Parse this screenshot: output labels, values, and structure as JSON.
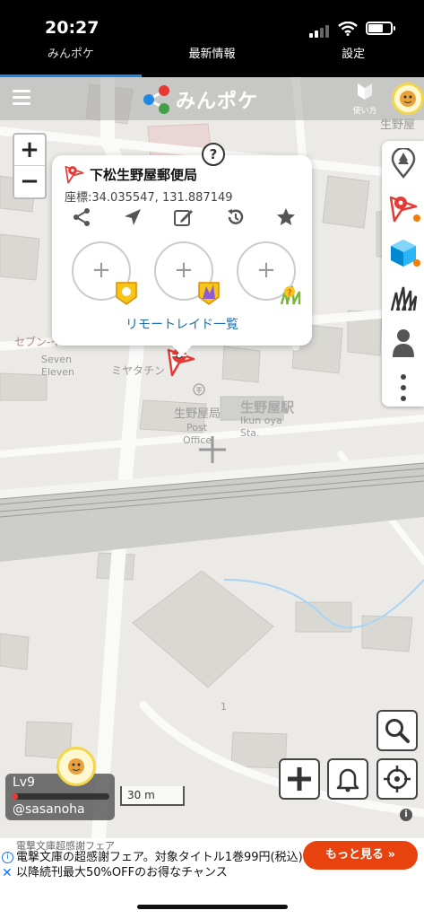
{
  "status_bar": {
    "time": "20:27"
  },
  "tabs": [
    {
      "label": "みんポケ",
      "active": true
    },
    {
      "label": "最新情報",
      "active": false
    },
    {
      "label": "設定",
      "active": false
    }
  ],
  "header": {
    "logo_text": "みんポケ",
    "howto_label": "使い方"
  },
  "zoom": {
    "in": "+",
    "out": "−"
  },
  "popup": {
    "help": "?",
    "title": "下松生野屋郵便局",
    "coords": "座標:34.035547, 131.887149",
    "add_symbol": "+",
    "raid_list_link": "リモートレイド一覧"
  },
  "map_labels": {
    "top_right": "生野屋",
    "seven_jp": "セブン‐イ",
    "seven_en1": "Seven",
    "seven_en2": "Eleven",
    "miyatake": "ミヤタチン",
    "post_jp": "生野屋局",
    "post_en1": "Post",
    "post_en2": "Office",
    "station_jp": "生野屋駅",
    "station_en1": "Ikun oya",
    "station_en2": "Sta.",
    "one": "1"
  },
  "player": {
    "level": "Lv9",
    "handle": "@sasanoha",
    "exp_fraction": 0.06
  },
  "scale": "30 m",
  "ad": {
    "small": "電撃文庫超感謝フェア",
    "text": "電撃文庫の超感謝フェア。対象タイトル1巻99円(税込)以降続刊最大50%OFFのお得なチャンス",
    "cta": "もっと見る"
  },
  "colors": {
    "accent": "#1e88e5",
    "cta": "#e8430e",
    "link": "#1f6fa8",
    "pin": "#e53935"
  }
}
